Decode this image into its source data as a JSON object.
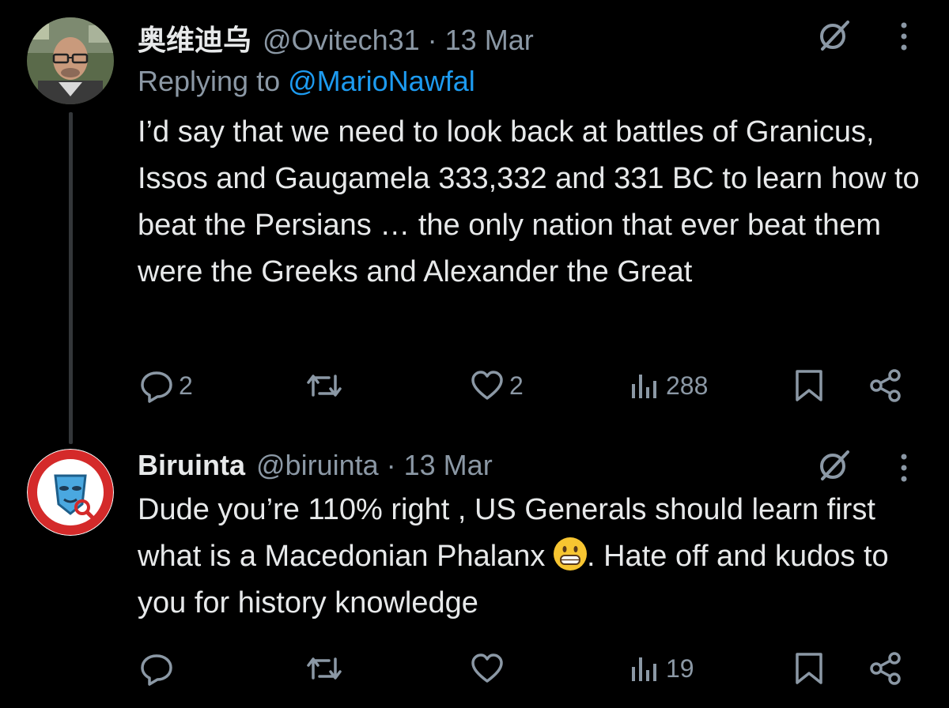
{
  "tweets": [
    {
      "display_name": "奥维迪乌",
      "handle": "@Ovitech31",
      "separator": "·",
      "date": "13 Mar",
      "replying_prefix": "Replying to",
      "replying_to": "@MarioNawfal",
      "body": "I’d say that we need to look back at battles of Granicus, Issos and Gaugamela 333,332 and 331 BC to learn how to beat the Persians … the only nation that ever beat them were the Greeks and Alexander the Great",
      "reply_count": "2",
      "retweet_count": "",
      "like_count": "2",
      "view_count": "288"
    },
    {
      "display_name": "Biruinta",
      "handle": "@biruinta",
      "separator": "·",
      "date": "13 Mar",
      "body_before_emoji": "Dude you’re 110% right , US Generals should learn first what is a Macedonian Phalanx ",
      "body_after_emoji": ". Hate off and kudos to you for history knowledge",
      "emoji": "grinning-face-emoji",
      "reply_count": "",
      "retweet_count": "",
      "like_count": "",
      "view_count": "19"
    }
  ],
  "colors": {
    "background": "#000000",
    "text": "#e7e9ea",
    "muted": "#8b98a5",
    "link": "#1d9bf0",
    "thread_line": "#333639"
  },
  "icons": [
    "grok-icon",
    "more-icon",
    "reply-icon",
    "retweet-icon",
    "like-icon",
    "views-icon",
    "bookmark-icon",
    "share-icon"
  ]
}
